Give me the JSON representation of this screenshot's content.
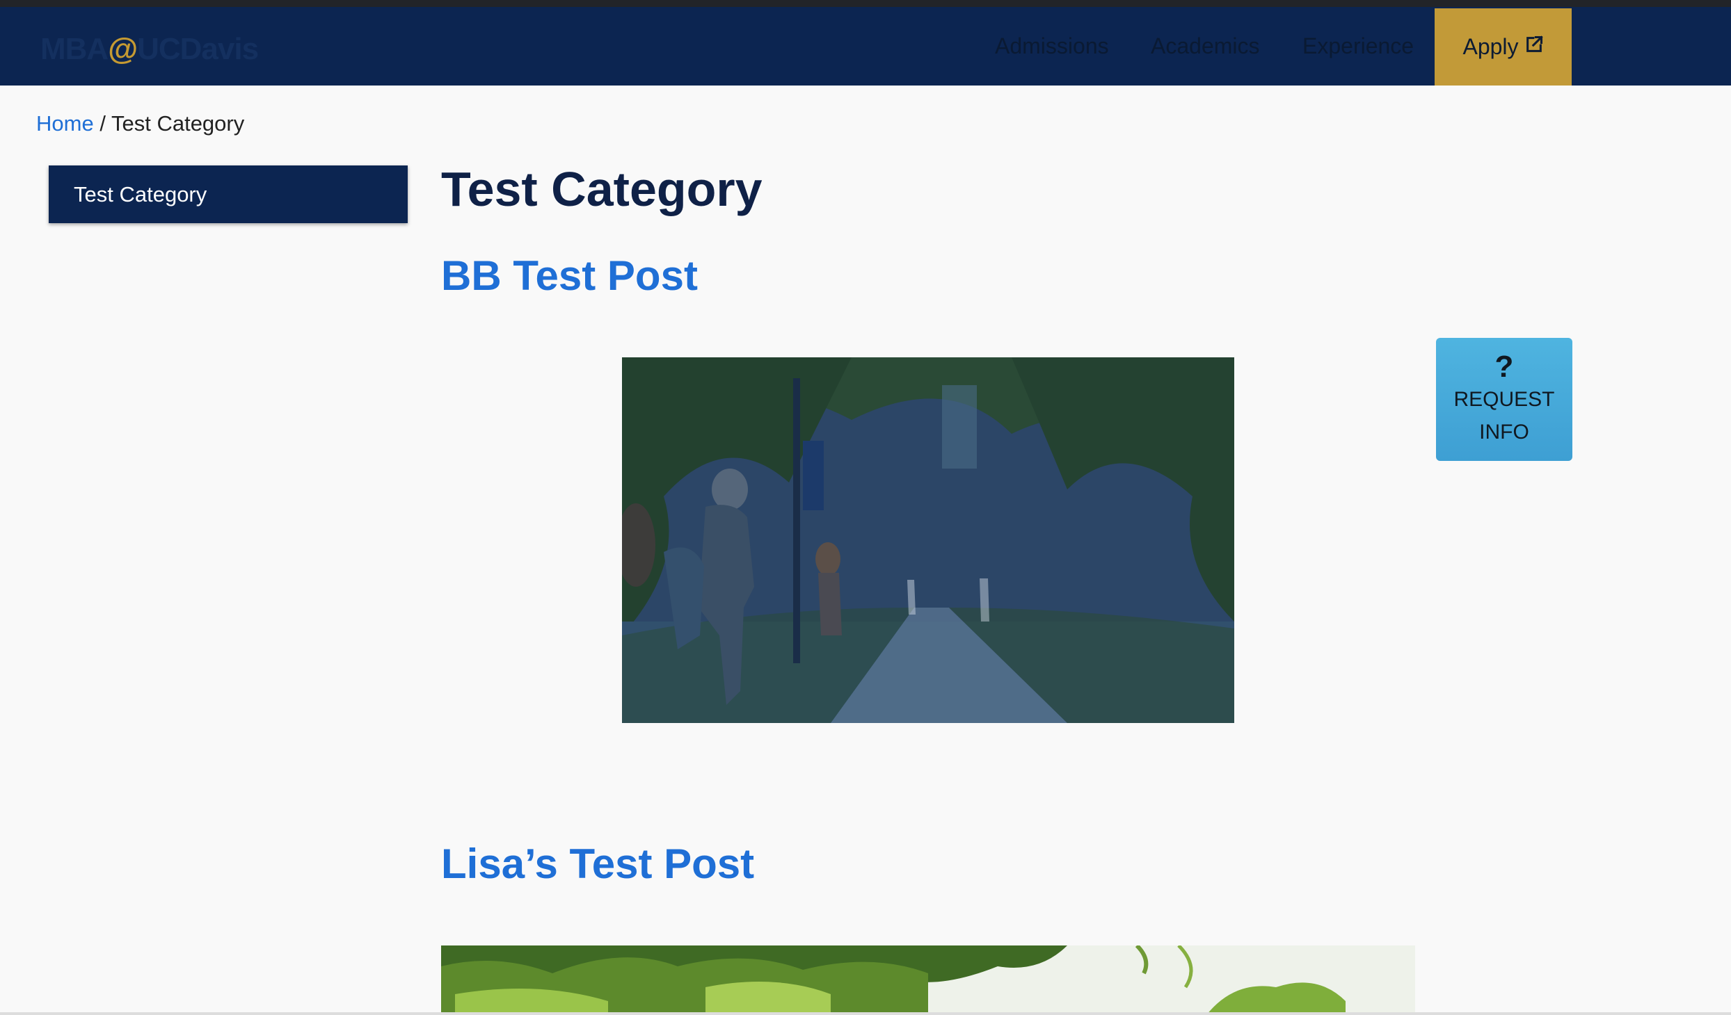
{
  "header": {
    "logo_prefix": "MBA",
    "logo_at": "@",
    "logo_suffix": "UCDavis",
    "nav": [
      {
        "label": "Admissions"
      },
      {
        "label": "Academics"
      },
      {
        "label": "Experience"
      }
    ],
    "apply_label": "Apply",
    "apply_icon": "external-link-icon",
    "colors": {
      "navbar": "#0c2551",
      "apply": "#c29a38"
    }
  },
  "breadcrumb": {
    "home": "Home",
    "separator": " / ",
    "current": "Test Category"
  },
  "sidebar": {
    "items": [
      {
        "label": "Test Category",
        "active": true
      }
    ]
  },
  "main": {
    "title": "Test Category",
    "posts": [
      {
        "title": "BB Test Post"
      },
      {
        "title": "Lisa’s Test Post"
      }
    ]
  },
  "request_info": {
    "icon": "question-icon",
    "glyph": "?",
    "line1": "REQUEST",
    "line2": "INFO",
    "color": "#4aaedc"
  }
}
